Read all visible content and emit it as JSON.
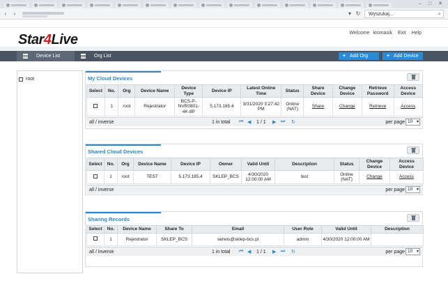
{
  "browser": {
    "search_placeholder": "Wyszukaj..."
  },
  "header": {
    "logo_star": "Star",
    "logo_four": "4",
    "logo_live": "Live",
    "welcome": "Welcome",
    "username": "ktomasik",
    "exit": "Exit",
    "help": "Help"
  },
  "toolbar": {
    "tabs": [
      {
        "label": "Device List"
      },
      {
        "label": "Org List"
      }
    ],
    "add_org": "Add Org",
    "add_device": "Add Device"
  },
  "tree": {
    "root_label": "root"
  },
  "my_cloud": {
    "title": "My Cloud Devices",
    "headers": [
      "Select",
      "No.",
      "Org",
      "Device Name",
      "Device Type",
      "Device IP",
      "Latest Online Time",
      "Status",
      "Share Device",
      "Change Device",
      "Retrieve Password",
      "Access Device"
    ],
    "row": {
      "no": "1",
      "org": "root",
      "name": "Rejestrator",
      "type": "BCS-P-NVR0801-4K-8P",
      "ip": "5.173.185.4",
      "time": "3/31/2020 3:27:42 PM",
      "status": "Online (NAT)",
      "share": "Share",
      "change": "Change",
      "retrieve": "Retrieve",
      "access": "Access"
    }
  },
  "shared_cloud": {
    "title": "Shared Cloud Devices",
    "headers": [
      "Select",
      "No.",
      "Org",
      "Device Name",
      "Device IP",
      "Owner",
      "Valid Until",
      "Description",
      "Status",
      "Change Device",
      "Access Device"
    ],
    "row": {
      "no": "1",
      "org": "root",
      "name": "TEST",
      "ip": "5.173.185.4",
      "owner": "SKLEP_BCS",
      "valid": "4/30/2020 12:00:00 AM",
      "description": "test",
      "status": "Online (NAT)",
      "change": "Change",
      "access": "Access"
    }
  },
  "sharing_records": {
    "title": "Sharing Records",
    "headers": [
      "Select",
      "No.",
      "Device Name",
      "Share To",
      "Email",
      "User Role",
      "Valid Until",
      "Description"
    ],
    "row": {
      "no": "1",
      "name": "Rejestrator",
      "share_to": "SKLEP_BCS",
      "email": "serwis@sklep-bcs.pl",
      "role": "admin",
      "valid": "4/30/2020 12:00:00 AM",
      "description": ""
    }
  },
  "pager": {
    "select_all": "all / inverse",
    "total": "1 in total",
    "page": "1 / 1",
    "per_page": "per page",
    "per_page_value": "10"
  },
  "colors": {
    "accent": "#2a86c8",
    "toolbar_bg": "#4a5563",
    "button_blue": "#2a8ad6",
    "logo_red": "#d21f1f"
  }
}
